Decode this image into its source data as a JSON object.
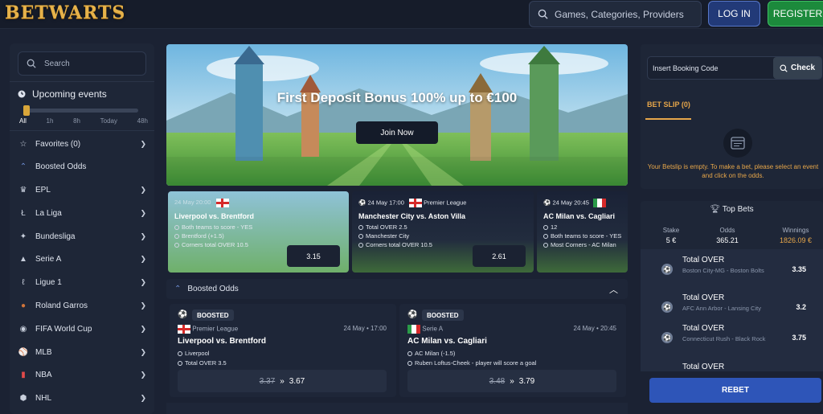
{
  "header": {
    "logo": "BETWARTS",
    "search_placeholder": "Games, Categories, Providers",
    "login_label": "LOG IN",
    "register_label": "REGISTER"
  },
  "sidebar": {
    "search_placeholder": "Search",
    "upcoming_title": "Upcoming events",
    "time_filters": [
      "All",
      "1h",
      "8h",
      "Today",
      "48h"
    ],
    "items": [
      {
        "label": "Favorites (0)",
        "icon": "star-icon",
        "has_chevron": true
      },
      {
        "label": "Boosted Odds",
        "icon": "boost-icon",
        "has_chevron": false
      },
      {
        "label": "EPL",
        "icon": "epl-icon",
        "has_chevron": true
      },
      {
        "label": "La Liga",
        "icon": "laliga-icon",
        "has_chevron": true
      },
      {
        "label": "Bundesliga",
        "icon": "bundesliga-icon",
        "has_chevron": true
      },
      {
        "label": "Serie A",
        "icon": "seriea-icon",
        "has_chevron": true
      },
      {
        "label": "Ligue 1",
        "icon": "ligue1-icon",
        "has_chevron": true
      },
      {
        "label": "Roland Garros",
        "icon": "tennis-icon",
        "has_chevron": true
      },
      {
        "label": "FIFA World Cup",
        "icon": "worldcup-icon",
        "has_chevron": true
      },
      {
        "label": "MLB",
        "icon": "mlb-icon",
        "has_chevron": true
      },
      {
        "label": "NBA",
        "icon": "nba-icon",
        "has_chevron": true
      },
      {
        "label": "NHL",
        "icon": "nhl-icon",
        "has_chevron": true
      }
    ]
  },
  "banner": {
    "title": "First Deposit Bonus 100% up to €100",
    "cta": "Join Now"
  },
  "match_cards": [
    {
      "time": "24 May 20:00",
      "title": "Liverpool vs. Brentford",
      "selections": [
        "Both teams to score - YES",
        "Brentford (+1.5)",
        "Corners total OVER 10.5"
      ],
      "odds": "3.15"
    },
    {
      "time": "24 May 17:00",
      "league": "Premier League",
      "title": "Manchester City vs. Aston Villa",
      "selections": [
        "Total OVER 2.5",
        "Manchester City",
        "Corners total OVER 10.5"
      ],
      "odds": "2.61"
    },
    {
      "time": "24 May 20:45",
      "title": "AC Milan vs. Cagliari",
      "selections": [
        "12",
        "Both teams to score - YES",
        "Most Corners - AC Milan"
      ]
    }
  ],
  "boosted": {
    "header": "Boosted Odds",
    "cards": [
      {
        "badge": "BOOSTED",
        "league": "Premier League",
        "datetime": "24 May • 17:00",
        "title": "Liverpool vs. Brentford",
        "selections": [
          "Liverpool",
          "Total OVER 3.5"
        ],
        "old_odds": "3.37",
        "new_odds": "3.67"
      },
      {
        "badge": "BOOSTED",
        "league": "Serie A",
        "datetime": "24 May • 20:45",
        "title": "AC Milan vs. Cagliari",
        "selections": [
          "AC Milan (-1.5)",
          "Ruben Loftus-Cheek - player will score a goal"
        ],
        "old_odds": "3.48",
        "new_odds": "3.79"
      }
    ]
  },
  "betslip": {
    "booking_placeholder": "Insert Booking Code",
    "check_label": "Check",
    "title": "BET SLIP (0)",
    "empty_message": "Your Betslip is empty. To make a bet, please select an event and click on the odds."
  },
  "top_bets": {
    "title": "Top Bets",
    "stake_label": "Stake",
    "stake_value": "5 €",
    "odds_label": "Odds",
    "odds_value": "365.21",
    "winnings_label": "Winnings",
    "winnings_value": "1826.09 €",
    "bets": [
      {
        "title": "Total OVER",
        "sub": "Boston City-MG - Boston Bolts",
        "odds": "3.35"
      },
      {
        "title": "Total OVER",
        "sub": "AFC Ann Arbor - Lansing City",
        "odds": "3.2"
      },
      {
        "title": "Total OVER",
        "sub": "Connecticut Rush - Black Rock",
        "odds": "3.75"
      },
      {
        "title": "Total OVER",
        "sub": "",
        "odds": ""
      }
    ],
    "rebet_label": "REBET"
  },
  "colors": {
    "background": "#1b2233",
    "accent_gold": "#e6a64a",
    "login_blue": "#223a78",
    "register_green": "#1c8a3c",
    "rebet_blue": "#2e55b8"
  }
}
